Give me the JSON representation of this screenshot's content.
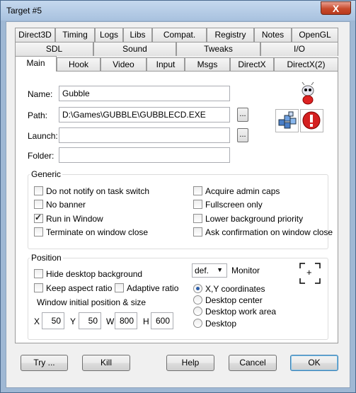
{
  "window": {
    "title": "Target #5",
    "close_glyph": "X"
  },
  "tabs": {
    "row1": [
      "Direct3D",
      "Timing",
      "Logs",
      "Libs",
      "Compat.",
      "Registry",
      "Notes",
      "OpenGL"
    ],
    "row2": [
      "SDL",
      "Sound",
      "Tweaks",
      "I/O"
    ],
    "row3": [
      "Main",
      "Hook",
      "Video",
      "Input",
      "Msgs",
      "DirectX",
      "DirectX(2)"
    ],
    "active": "Main"
  },
  "fields": {
    "name": {
      "label": "Name:",
      "value": "Gubble"
    },
    "path": {
      "label": "Path:",
      "value": "D:\\Games\\GUBBLE\\GUBBLECD.EXE"
    },
    "launch": {
      "label": "Launch:",
      "value": ""
    },
    "folder": {
      "label": "Folder:",
      "value": ""
    },
    "browse_label": "..."
  },
  "generic": {
    "title": "Generic",
    "left": [
      {
        "label": "Do not notify on task switch",
        "checked": false
      },
      {
        "label": "No banner",
        "checked": false
      },
      {
        "label": "Run in Window",
        "checked": true
      },
      {
        "label": "Terminate on window close",
        "checked": false
      }
    ],
    "right": [
      {
        "label": "Acquire admin caps",
        "checked": false
      },
      {
        "label": "Fullscreen only",
        "checked": false
      },
      {
        "label": "Lower background priority",
        "checked": false
      },
      {
        "label": "Ask confirmation on window close",
        "checked": false
      }
    ]
  },
  "position": {
    "title": "Position",
    "hide_desktop": {
      "label": "Hide desktop background",
      "checked": false
    },
    "keep_aspect": {
      "label": "Keep aspect ratio",
      "checked": false
    },
    "adaptive": {
      "label": "Adaptive ratio",
      "checked": false
    },
    "initial_label": "Window initial position & size",
    "x_label": "X",
    "x": "50",
    "y_label": "Y",
    "y": "50",
    "w_label": "W",
    "w": "800",
    "h_label": "H",
    "h": "600",
    "monitor_value": "def.",
    "monitor_label": "Monitor",
    "radios": [
      {
        "label": "X,Y coordinates",
        "checked": true
      },
      {
        "label": "Desktop center",
        "checked": false
      },
      {
        "label": "Desktop work area",
        "checked": false
      },
      {
        "label": "Desktop",
        "checked": false
      }
    ],
    "crosshair_glyph": "+"
  },
  "buttons": {
    "try": "Try ...",
    "kill": "Kill",
    "help": "Help",
    "cancel": "Cancel",
    "ok": "OK"
  },
  "colors": {
    "titlebar": "#a9c2df",
    "close": "#c84a2c",
    "accent": "#2a5da8"
  }
}
